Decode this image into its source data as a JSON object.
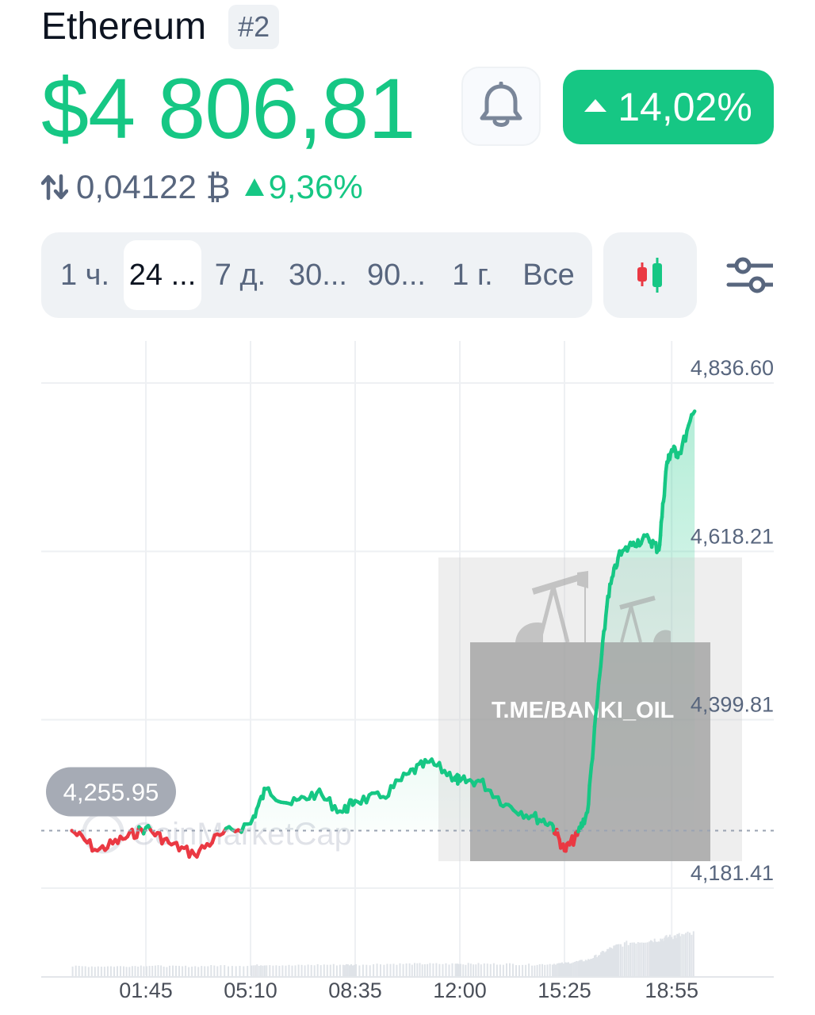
{
  "header": {
    "coin_name": "Ethereum",
    "rank": "#2",
    "price": "$4 806,81",
    "change_24h": "14,02%",
    "btc_price": "0,04122 ₿",
    "btc_change": "9,36%"
  },
  "icons": {
    "alert": "bell-icon",
    "swap": "swap-arrows-icon",
    "chart_type": "candlestick-icon",
    "settings": "sliders-icon"
  },
  "tabs": [
    {
      "label": "1 ч.",
      "active": false
    },
    {
      "label": "24 ...",
      "active": true
    },
    {
      "label": "7 д.",
      "active": false
    },
    {
      "label": "30...",
      "active": false
    },
    {
      "label": "90...",
      "active": false
    },
    {
      "label": "1 г.",
      "active": false
    },
    {
      "label": "Все",
      "active": false
    }
  ],
  "chart": {
    "baseline_label": "4,255.95",
    "watermark": "CoinMarketCap",
    "overlay_text": "T.ME/BANKI_OIL"
  },
  "colors": {
    "up": "#16c784",
    "down": "#ea3943",
    "text_secondary": "#58667e",
    "tab_bg": "#eff2f5"
  },
  "chart_data": {
    "type": "line",
    "y_ticks": [
      4836.6,
      4618.21,
      4399.81,
      4181.41
    ],
    "y_tick_labels": [
      "4,836.60",
      "4,618.21",
      "4,399.81",
      "4,181.41"
    ],
    "ylim": [
      4181.41,
      4836.6
    ],
    "baseline": 4255.95,
    "x_tick_labels": [
      "01:45",
      "05:10",
      "08:35",
      "12:00",
      "15:25",
      "18:55"
    ],
    "grid": true,
    "series": [
      {
        "x": [
          "23:20",
          "00:10",
          "01:00",
          "01:45",
          "02:30",
          "03:20",
          "04:10",
          "05:10",
          "05:40",
          "06:30",
          "07:20",
          "08:10",
          "08:35",
          "09:30",
          "10:20",
          "11:00",
          "11:50",
          "12:00",
          "12:40",
          "13:30",
          "14:20",
          "15:00",
          "15:25",
          "15:50",
          "16:10",
          "16:30",
          "16:50",
          "17:10",
          "17:40",
          "18:10",
          "18:30",
          "18:45",
          "18:55",
          "19:10",
          "19:40"
        ],
        "values": [
          4256,
          4230,
          4245,
          4260,
          4240,
          4225,
          4250,
          4265,
          4310,
          4290,
          4305,
          4280,
          4295,
          4300,
          4330,
          4345,
          4325,
          4320,
          4320,
          4290,
          4275,
          4265,
          4230,
          4250,
          4280,
          4430,
          4560,
          4610,
          4630,
          4635,
          4620,
          4730,
          4750,
          4745,
          4800
        ]
      }
    ],
    "volume": [
      12,
      12,
      12,
      13,
      12,
      12,
      13,
      13,
      14,
      13,
      14,
      14,
      14,
      15,
      15,
      15,
      15,
      15,
      15,
      15,
      14,
      15,
      16,
      18,
      20,
      26,
      33,
      38,
      42,
      44,
      45,
      47,
      48,
      50,
      52
    ]
  }
}
